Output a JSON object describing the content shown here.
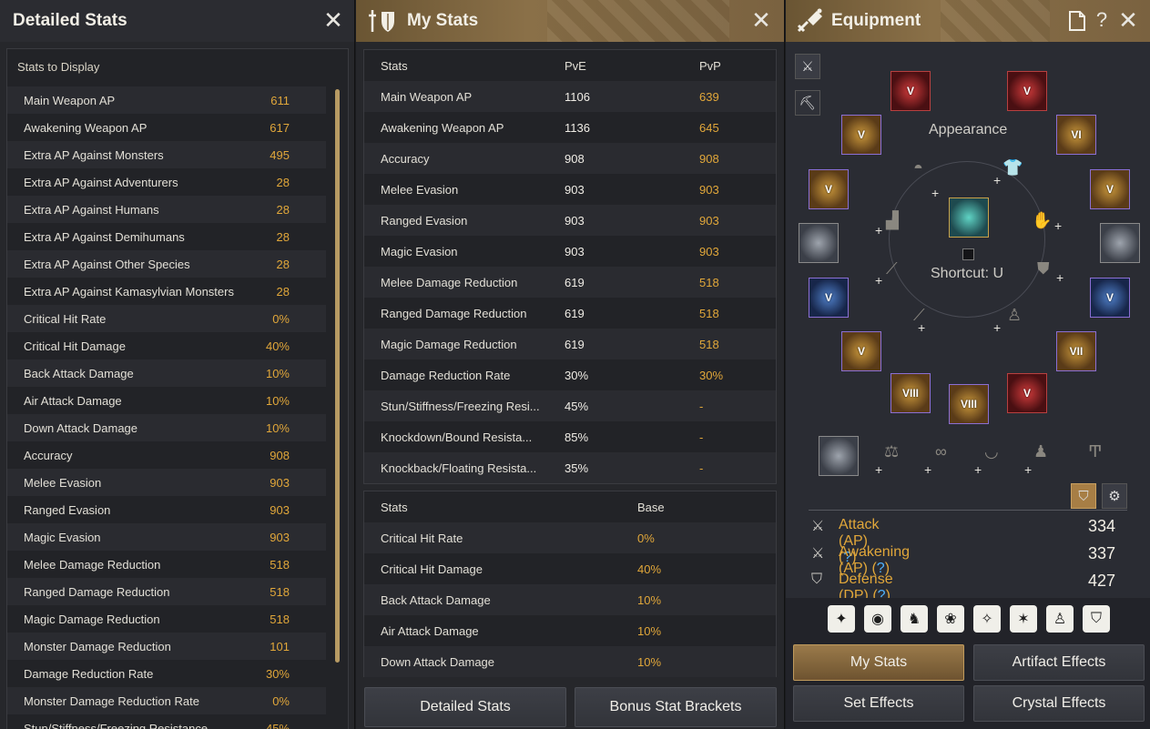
{
  "detailed": {
    "title": "Detailed Stats",
    "display_label": "Stats to Display",
    "rows": [
      {
        "label": "Main Weapon AP",
        "value": "611"
      },
      {
        "label": "Awakening Weapon AP",
        "value": "617"
      },
      {
        "label": "Extra AP Against Monsters",
        "value": "495"
      },
      {
        "label": "Extra AP Against Adventurers",
        "value": "28"
      },
      {
        "label": "Extra AP Against Humans",
        "value": "28"
      },
      {
        "label": "Extra AP Against Demihumans",
        "value": "28"
      },
      {
        "label": "Extra AP Against Other Species",
        "value": "28"
      },
      {
        "label": "Extra AP Against Kamasylvian Monsters",
        "value": "28"
      },
      {
        "label": "Critical Hit Rate",
        "value": "0%"
      },
      {
        "label": "Critical Hit Damage",
        "value": "40%"
      },
      {
        "label": "Back Attack Damage",
        "value": "10%"
      },
      {
        "label": "Air Attack Damage",
        "value": "10%"
      },
      {
        "label": "Down Attack Damage",
        "value": "10%"
      },
      {
        "label": "Accuracy",
        "value": "908"
      },
      {
        "label": "Melee Evasion",
        "value": "903"
      },
      {
        "label": "Ranged Evasion",
        "value": "903"
      },
      {
        "label": "Magic Evasion",
        "value": "903"
      },
      {
        "label": "Melee Damage Reduction",
        "value": "518"
      },
      {
        "label": "Ranged Damage Reduction",
        "value": "518"
      },
      {
        "label": "Magic Damage Reduction",
        "value": "518"
      },
      {
        "label": "Monster Damage Reduction",
        "value": "101"
      },
      {
        "label": "Damage Reduction Rate",
        "value": "30%"
      },
      {
        "label": "Monster Damage Reduction Rate",
        "value": "0%"
      },
      {
        "label": "Stun/Stiffness/Freezing Resistance",
        "value": "45%"
      }
    ]
  },
  "mystats": {
    "title": "My Stats",
    "table1": {
      "headers": [
        "Stats",
        "PvE",
        "PvP"
      ],
      "rows": [
        [
          "Main Weapon AP",
          "1106",
          "639"
        ],
        [
          "Awakening Weapon AP",
          "1136",
          "645"
        ],
        [
          "Accuracy",
          "908",
          "908"
        ],
        [
          "Melee Evasion",
          "903",
          "903"
        ],
        [
          "Ranged Evasion",
          "903",
          "903"
        ],
        [
          "Magic Evasion",
          "903",
          "903"
        ],
        [
          "Melee Damage Reduction",
          "619",
          "518"
        ],
        [
          "Ranged Damage Reduction",
          "619",
          "518"
        ],
        [
          "Magic Damage Reduction",
          "619",
          "518"
        ],
        [
          "Damage Reduction Rate",
          "30%",
          "30%"
        ],
        [
          "Stun/Stiffness/Freezing Resi...",
          "45%",
          "-"
        ],
        [
          "Knockdown/Bound Resista...",
          "85%",
          "-"
        ],
        [
          "Knockback/Floating Resista...",
          "35%",
          "-"
        ]
      ]
    },
    "table2": {
      "headers": [
        "Stats",
        "Base"
      ],
      "rows": [
        [
          "Critical Hit Rate",
          "0%"
        ],
        [
          "Critical Hit Damage",
          "40%"
        ],
        [
          "Back Attack Damage",
          "10%"
        ],
        [
          "Air Attack Damage",
          "10%"
        ],
        [
          "Down Attack Damage",
          "10%"
        ]
      ]
    },
    "buttons": {
      "detailed": "Detailed Stats",
      "brackets": "Bonus Stat Brackets"
    }
  },
  "equipment": {
    "title": "Equipment",
    "appearance": "Appearance",
    "shortcut": "Shortcut: U",
    "slots": [
      "V",
      "V",
      "V",
      "VI",
      "V",
      "V",
      "V",
      "V",
      "V",
      "VII",
      "VIII",
      "VIII",
      "V"
    ],
    "stats": [
      {
        "label": "Attack (AP)",
        "q": "?",
        "value": "334"
      },
      {
        "label": "Awakening (AP)",
        "q": "?",
        "value": "337"
      },
      {
        "label": "Defense (DP)",
        "q": "?",
        "value": "427"
      }
    ],
    "buttons": {
      "mystats": "My Stats",
      "artifact": "Artifact Effects",
      "set": "Set Effects",
      "crystal": "Crystal Effects"
    },
    "colors": {
      "accent": "#e1a73a",
      "active_button": "#8a6a3e",
      "slot_border": "#8b6fd4"
    }
  }
}
